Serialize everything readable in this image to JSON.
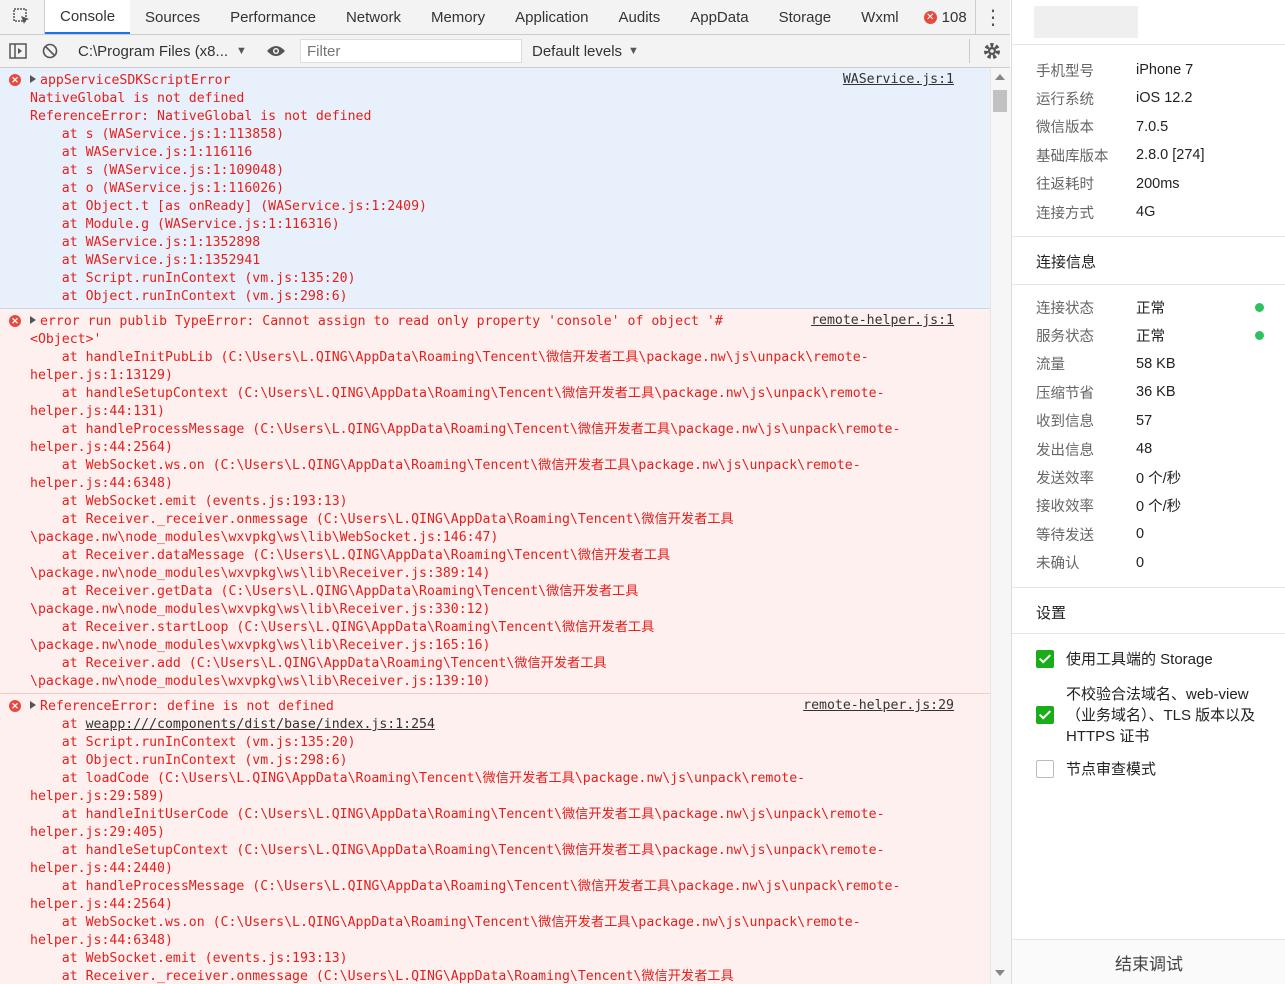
{
  "tabs": [
    "Console",
    "Sources",
    "Performance",
    "Network",
    "Memory",
    "Application",
    "Audits",
    "AppData",
    "Storage",
    "Wxml"
  ],
  "active_tab": "Console",
  "error_count": "108",
  "toolbar": {
    "context": "C:\\Program Files (x8...",
    "filter_placeholder": "Filter",
    "levels": "Default levels"
  },
  "messages": [
    {
      "source": "WAService.js:1",
      "lines": [
        "appServiceSDKScriptError",
        "NativeGlobal is not defined",
        "ReferenceError: NativeGlobal is not defined",
        "    at s (WAService.js:1:113858)",
        "    at WAService.js:1:116116",
        "    at s (WAService.js:1:109048)",
        "    at o (WAService.js:1:116026)",
        "    at Object.t [as onReady] (WAService.js:1:2409)",
        "    at Module.g (WAService.js:1:116316)",
        "    at WAService.js:1:1352898",
        "    at WAService.js:1:1352941",
        "    at Script.runInContext (vm.js:135:20)",
        "    at Object.runInContext (vm.js:298:6)"
      ]
    },
    {
      "source": "remote-helper.js:1",
      "lines": [
        "error run publib TypeError: Cannot assign to read only property 'console' of object '#",
        "<Object>'",
        "    at handleInitPubLib (C:\\Users\\L.QING\\AppData\\Roaming\\Tencent\\微信开发者工具\\package.nw\\js\\unpack\\remote-",
        "helper.js:1:13129)",
        "    at handleSetupContext (C:\\Users\\L.QING\\AppData\\Roaming\\Tencent\\微信开发者工具\\package.nw\\js\\unpack\\remote-",
        "helper.js:44:131)",
        "    at handleProcessMessage (C:\\Users\\L.QING\\AppData\\Roaming\\Tencent\\微信开发者工具\\package.nw\\js\\unpack\\remote-",
        "helper.js:44:2564)",
        "    at WebSocket.ws.on (C:\\Users\\L.QING\\AppData\\Roaming\\Tencent\\微信开发者工具\\package.nw\\js\\unpack\\remote-",
        "helper.js:44:6348)",
        "    at WebSocket.emit (events.js:193:13)",
        "    at Receiver._receiver.onmessage (C:\\Users\\L.QING\\AppData\\Roaming\\Tencent\\微信开发者工具",
        "\\package.nw\\node_modules\\wxvpkg\\ws\\lib\\WebSocket.js:146:47)",
        "    at Receiver.dataMessage (C:\\Users\\L.QING\\AppData\\Roaming\\Tencent\\微信开发者工具",
        "\\package.nw\\node_modules\\wxvpkg\\ws\\lib\\Receiver.js:389:14)",
        "    at Receiver.getData (C:\\Users\\L.QING\\AppData\\Roaming\\Tencent\\微信开发者工具",
        "\\package.nw\\node_modules\\wxvpkg\\ws\\lib\\Receiver.js:330:12)",
        "    at Receiver.startLoop (C:\\Users\\L.QING\\AppData\\Roaming\\Tencent\\微信开发者工具",
        "\\package.nw\\node_modules\\wxvpkg\\ws\\lib\\Receiver.js:165:16)",
        "    at Receiver.add (C:\\Users\\L.QING\\AppData\\Roaming\\Tencent\\微信开发者工具",
        "\\package.nw\\node_modules\\wxvpkg\\ws\\lib\\Receiver.js:139:10)"
      ]
    },
    {
      "source": "remote-helper.js:29",
      "link": "weapp:///components/dist/base/index.js:1:254",
      "lines": [
        "ReferenceError: define is not defined",
        "    at ",
        "    at Script.runInContext (vm.js:135:20)",
        "    at Object.runInContext (vm.js:298:6)",
        "    at loadCode (C:\\Users\\L.QING\\AppData\\Roaming\\Tencent\\微信开发者工具\\package.nw\\js\\unpack\\remote-",
        "helper.js:29:589)",
        "    at handleInitUserCode (C:\\Users\\L.QING\\AppData\\Roaming\\Tencent\\微信开发者工具\\package.nw\\js\\unpack\\remote-",
        "helper.js:29:405)",
        "    at handleSetupContext (C:\\Users\\L.QING\\AppData\\Roaming\\Tencent\\微信开发者工具\\package.nw\\js\\unpack\\remote-",
        "helper.js:44:2440)",
        "    at handleProcessMessage (C:\\Users\\L.QING\\AppData\\Roaming\\Tencent\\微信开发者工具\\package.nw\\js\\unpack\\remote-",
        "helper.js:44:2564)",
        "    at WebSocket.ws.on (C:\\Users\\L.QING\\AppData\\Roaming\\Tencent\\微信开发者工具\\package.nw\\js\\unpack\\remote-",
        "helper.js:44:6348)",
        "    at WebSocket.emit (events.js:193:13)",
        "    at Receiver._receiver.onmessage (C:\\Users\\L.QING\\AppData\\Roaming\\Tencent\\微信开发者工具"
      ]
    }
  ],
  "device": [
    {
      "k": "手机型号",
      "v": "iPhone 7"
    },
    {
      "k": "运行系统",
      "v": "iOS 12.2"
    },
    {
      "k": "微信版本",
      "v": "7.0.5"
    },
    {
      "k": "基础库版本",
      "v": "2.8.0 [274]"
    },
    {
      "k": "往返耗时",
      "v": "200ms"
    },
    {
      "k": "连接方式",
      "v": "4G"
    }
  ],
  "connection_title": "连接信息",
  "connection": [
    {
      "k": "连接状态",
      "v": "正常",
      "ok": true
    },
    {
      "k": "服务状态",
      "v": "正常",
      "ok": true
    },
    {
      "k": "流量",
      "v": "58 KB"
    },
    {
      "k": "压缩节省",
      "v": "36 KB"
    },
    {
      "k": "收到信息",
      "v": "57"
    },
    {
      "k": "发出信息",
      "v": "48"
    },
    {
      "k": "发送效率",
      "v": "0 个/秒"
    },
    {
      "k": "接收效率",
      "v": "0 个/秒"
    },
    {
      "k": "等待发送",
      "v": "0"
    },
    {
      "k": "未确认",
      "v": "0"
    }
  ],
  "settings_title": "设置",
  "settings": [
    {
      "label": "使用工具端的 Storage",
      "checked": true
    },
    {
      "label": "不校验合法域名、web-view（业务域名）、TLS 版本以及 HTTPS 证书",
      "checked": true
    },
    {
      "label": "节点审查模式",
      "checked": false
    }
  ],
  "end_button": "结束调试",
  "status_colors": {
    "error": "#e3201c",
    "ok": "#2ec25f",
    "accent": "#1aad19"
  }
}
